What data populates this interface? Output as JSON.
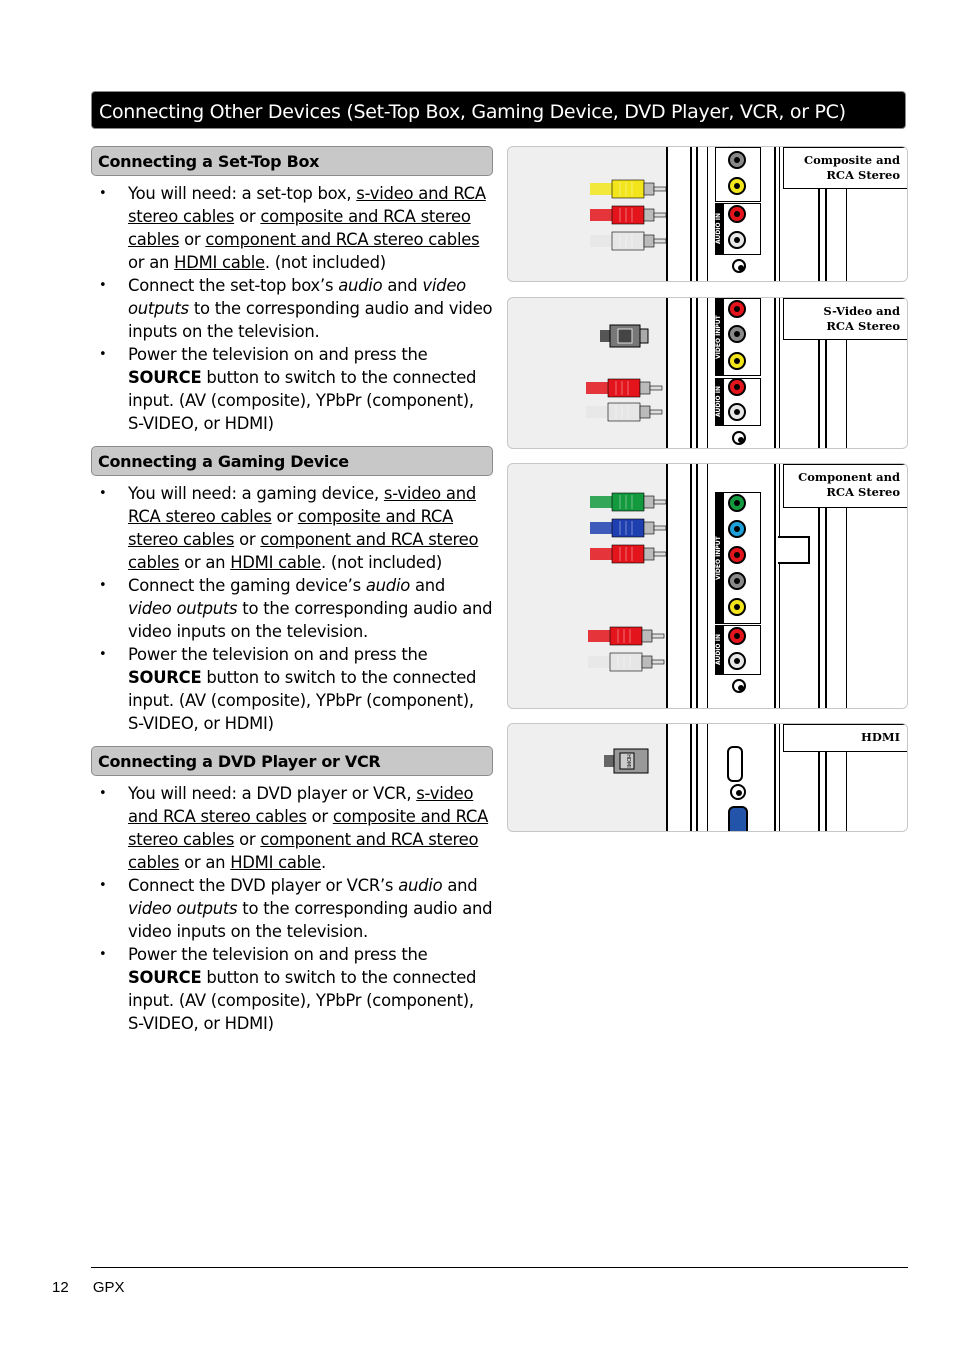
{
  "page_title": "Connecting Other Devices (Set-Top Box, Gaming Device, DVD Player, VCR, or PC)",
  "sections": [
    {
      "heading": "Connecting a Set-Top Box",
      "bullets": [
        [
          {
            "t": "You will need: a set-top box, "
          },
          {
            "t": "s-video and RCA stereo cables",
            "link": true
          },
          {
            "t": " or "
          },
          {
            "t": "composite and RCA stereo cables",
            "link": true
          },
          {
            "t": " or "
          },
          {
            "t": "component and RCA stereo cables",
            "link": true
          },
          {
            "t": " or an "
          },
          {
            "t": "HDMI cable",
            "link": true
          },
          {
            "t": ". (not included)"
          }
        ],
        [
          {
            "t": "Connect the set-top box’s "
          },
          {
            "t": "audio",
            "italic": true
          },
          {
            "t": " and "
          },
          {
            "t": "video outputs",
            "italic": true
          },
          {
            "t": " to the corresponding audio and video inputs on the television."
          }
        ],
        [
          {
            "t": "Power the television on and press the "
          },
          {
            "t": "SOURCE",
            "bold": true
          },
          {
            "t": " button to switch to the connected input. (AV (composite), YPbPr (component), S-VIDEO, or HDMI)"
          }
        ]
      ]
    },
    {
      "heading": "Connecting a Gaming Device",
      "bullets": [
        [
          {
            "t": "You will need: a gaming device, "
          },
          {
            "t": "s-video and RCA stereo cables",
            "link": true
          },
          {
            "t": " or "
          },
          {
            "t": "composite and RCA stereo cables",
            "link": true
          },
          {
            "t": " or "
          },
          {
            "t": "component and RCA stereo cables",
            "link": true
          },
          {
            "t": " or an "
          },
          {
            "t": "HDMI cable",
            "link": true
          },
          {
            "t": ". (not included)"
          }
        ],
        [
          {
            "t": "Connect the gaming device’s "
          },
          {
            "t": "audio",
            "italic": true
          },
          {
            "t": " and "
          },
          {
            "t": "video outputs",
            "italic": true
          },
          {
            "t": " to the corresponding audio and video inputs on the television."
          }
        ],
        [
          {
            "t": "Power the television on and press the "
          },
          {
            "t": "SOURCE",
            "bold": true
          },
          {
            "t": " button to switch to the connected input. (AV (composite), YPbPr (component), S-VIDEO, or HDMI)"
          }
        ]
      ]
    },
    {
      "heading": "Connecting a DVD Player or VCR",
      "bullets": [
        [
          {
            "t": "You will need: a DVD player or VCR, "
          },
          {
            "t": "s-video and RCA stereo cables",
            "link": true
          },
          {
            "t": " or "
          },
          {
            "t": "composite and RCA stereo cables",
            "link": true
          },
          {
            "t": " or "
          },
          {
            "t": "component and RCA stereo cables",
            "link": true
          },
          {
            "t": " or an "
          },
          {
            "t": "HDMI cable",
            "link": true
          },
          {
            "t": "."
          }
        ],
        [
          {
            "t": "Connect the DVD player or VCR’s "
          },
          {
            "t": "audio",
            "italic": true
          },
          {
            "t": " and "
          },
          {
            "t": "video outputs",
            "italic": true
          },
          {
            "t": " to the corresponding audio and video inputs on the television."
          }
        ],
        [
          {
            "t": "Power the television on and press the "
          },
          {
            "t": "SOURCE",
            "bold": true
          },
          {
            "t": " button to switch to the connected input. (AV (composite), YPbPr (component), S-VIDEO, or HDMI)"
          }
        ]
      ]
    }
  ],
  "diagrams": [
    {
      "caption_line1": "Composite and",
      "caption_line2": "RCA Stereo",
      "ports": [
        "S-VIDEO",
        "VIDEO",
        "AUDIO IN R",
        "AUDIO IN L"
      ]
    },
    {
      "caption_line1": "S-Video and",
      "caption_line2": "RCA Stereo",
      "ports": [
        "Pr",
        "S-VIDEO",
        "VIDEO",
        "AUDIO IN R",
        "AUDIO IN L"
      ]
    },
    {
      "caption_line1": "Component and",
      "caption_line2": "RCA Stereo",
      "ports": [
        "Y",
        "Pb",
        "Pr",
        "S-VIDEO",
        "VIDEO",
        "AUDIO IN R",
        "AUDIO IN L"
      ]
    },
    {
      "caption_line1": "",
      "caption_line2": "HDMI",
      "ports": [
        "HDMI",
        "PC AUDIO",
        "VGA"
      ]
    }
  ],
  "port_panel_labels": {
    "video_input": "VIDEO INPUT",
    "audio_in": "AUDIO IN"
  },
  "hdmi_plug_label": "HDMI",
  "colors": {
    "yellow": "#f2e51b",
    "red": "#e3141b",
    "white": "#e6e6e6",
    "green": "#139a3e",
    "blue": "#1e3fb0",
    "cyan": "#1ea0d8",
    "header_gray": "#c8c8c8",
    "panel_bg": "#efefef"
  },
  "footer": {
    "page_number": "12",
    "brand": "GPX"
  }
}
